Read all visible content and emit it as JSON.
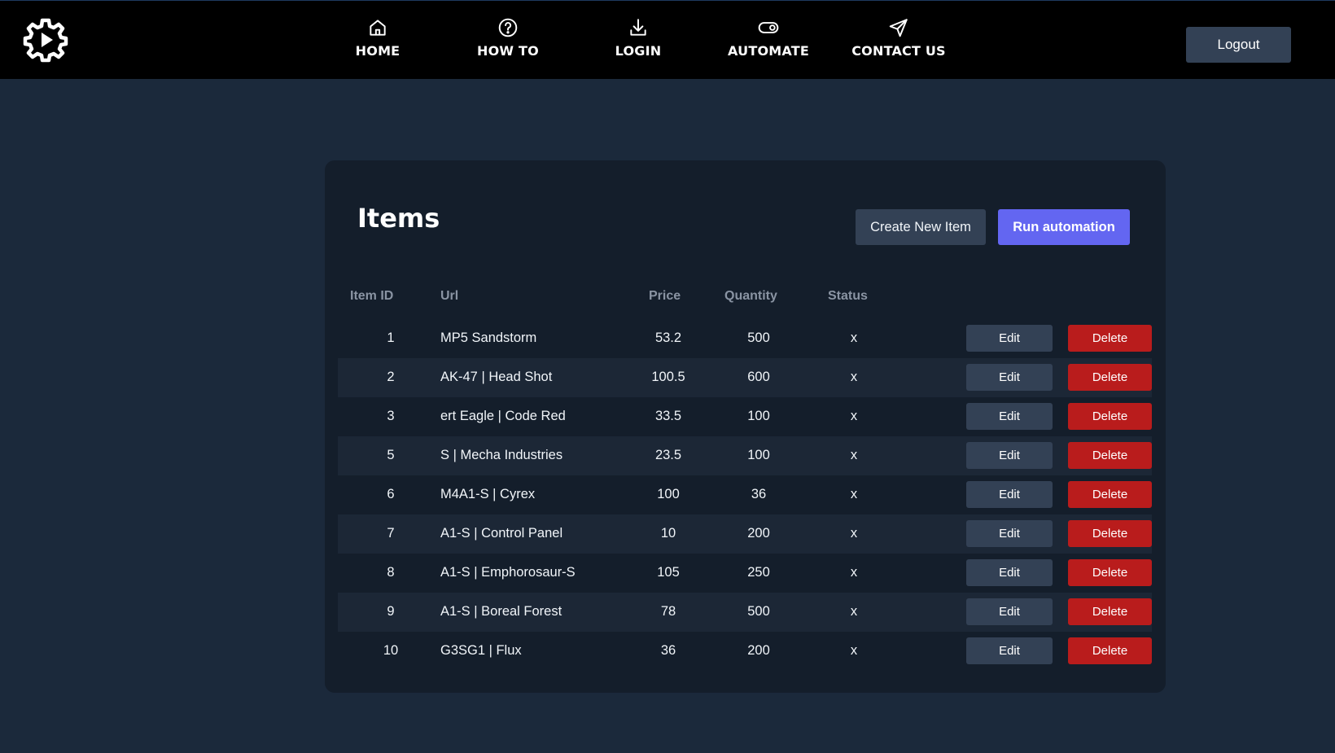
{
  "colors": {
    "page_bg": "#1b293b",
    "navbar_bg": "#000000",
    "card_bg": "#141e2b",
    "row_alt_bg": "#1c2736",
    "primary": "#6366f1",
    "secondary": "#334155",
    "danger": "#b91c1c"
  },
  "navbar": {
    "logo_icon": "gear-play-icon",
    "links": [
      {
        "label": "HOME",
        "icon": "home-icon"
      },
      {
        "label": "HOW TO",
        "icon": "help-circle-icon"
      },
      {
        "label": "LOGIN",
        "icon": "download-icon"
      },
      {
        "label": "AUTOMATE",
        "icon": "toggle-icon"
      },
      {
        "label": "CONTACT US",
        "icon": "send-icon"
      }
    ],
    "logout_label": "Logout"
  },
  "main": {
    "title": "Items",
    "create_button": "Create New Item",
    "run_button": "Run automation",
    "table": {
      "headers": [
        "Item ID",
        "Url",
        "Price",
        "Quantity",
        "Status"
      ],
      "edit_label": "Edit",
      "delete_label": "Delete",
      "rows": [
        {
          "id": "1",
          "url": "MP5 Sandstorm",
          "price": "53.2",
          "quantity": "500",
          "status": "x"
        },
        {
          "id": "2",
          "url": "AK-47 | Head Shot",
          "price": "100.5",
          "quantity": "600",
          "status": "x"
        },
        {
          "id": "3",
          "url": "ert Eagle | Code Red",
          "price": "33.5",
          "quantity": "100",
          "status": "x"
        },
        {
          "id": "5",
          "url": "S | Mecha Industries",
          "price": "23.5",
          "quantity": "100",
          "status": "x"
        },
        {
          "id": "6",
          "url": "M4A1-S | Cyrex",
          "price": "100",
          "quantity": "36",
          "status": "x"
        },
        {
          "id": "7",
          "url": "A1-S | Control Panel",
          "price": "10",
          "quantity": "200",
          "status": "x"
        },
        {
          "id": "8",
          "url": "A1-S | Emphorosaur-S",
          "price": "105",
          "quantity": "250",
          "status": "x"
        },
        {
          "id": "9",
          "url": "A1-S | Boreal Forest",
          "price": "78",
          "quantity": "500",
          "status": "x"
        },
        {
          "id": "10",
          "url": "G3SG1 | Flux",
          "price": "36",
          "quantity": "200",
          "status": "x"
        }
      ]
    }
  }
}
